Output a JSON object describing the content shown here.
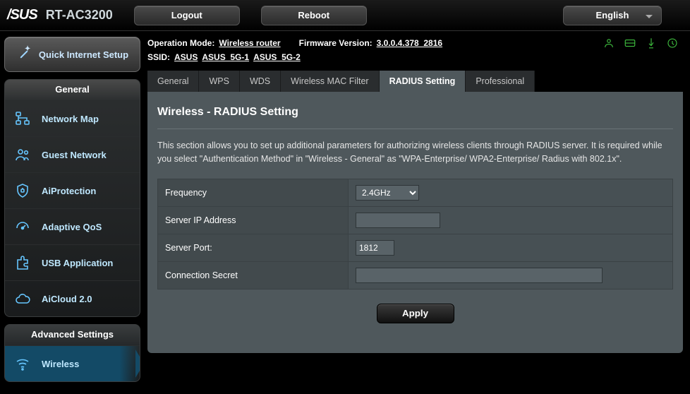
{
  "brand": "/SUS",
  "model": "RT-AC3200",
  "top": {
    "logout": "Logout",
    "reboot": "Reboot",
    "language": "English"
  },
  "qis": "Quick Internet Setup",
  "sidebar": {
    "general_head": "General",
    "advanced_head": "Advanced Settings",
    "general": [
      {
        "label": "Network Map"
      },
      {
        "label": "Guest Network"
      },
      {
        "label": "AiProtection"
      },
      {
        "label": "Adaptive QoS"
      },
      {
        "label": "USB Application"
      },
      {
        "label": "AiCloud 2.0"
      }
    ],
    "advanced": [
      {
        "label": "Wireless"
      }
    ]
  },
  "info": {
    "opmode_label": "Operation Mode:",
    "opmode_value": "Wireless router",
    "fw_label": "Firmware Version:",
    "fw_value": "3.0.0.4.378_2816",
    "ssid_label": "SSID:",
    "ssid_values": [
      "ASUS",
      "ASUS_5G-1",
      "ASUS_5G-2"
    ]
  },
  "tabs": [
    "General",
    "WPS",
    "WDS",
    "Wireless MAC Filter",
    "RADIUS Setting",
    "Professional"
  ],
  "active_tab": "RADIUS Setting",
  "card": {
    "title": "Wireless - RADIUS Setting",
    "desc": "This section allows you to set up additional parameters for authorizing wireless clients through RADIUS server. It is required while you select \"Authentication Method\" in \"Wireless - General\" as \"WPA-Enterprise/ WPA2-Enterprise/ Radius with 802.1x\"."
  },
  "form": {
    "frequency_label": "Frequency",
    "frequency_value": "2.4GHz",
    "server_ip_label": "Server IP Address",
    "server_ip_value": "",
    "server_port_label": "Server Port:",
    "server_port_value": "1812",
    "secret_label": "Connection Secret",
    "secret_value": "",
    "apply": "Apply"
  }
}
